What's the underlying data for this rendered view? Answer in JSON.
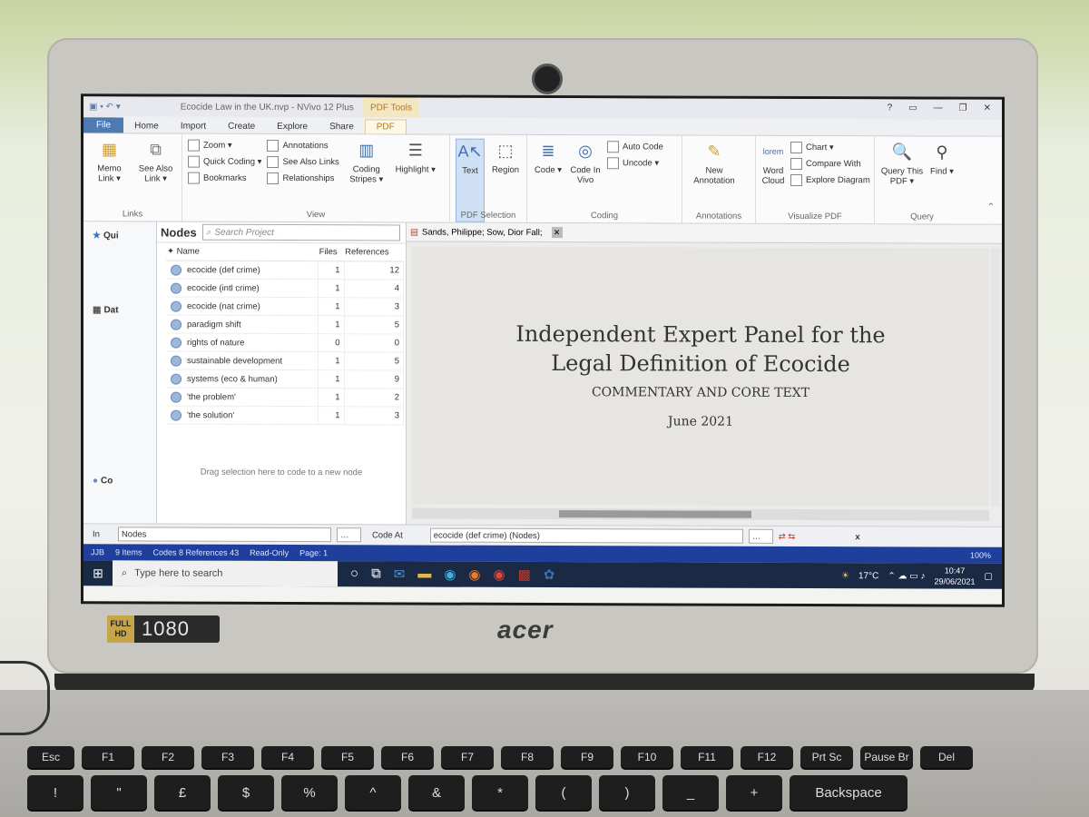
{
  "app": {
    "window_title": "Ecocide Law in the UK.nvp - NVivo 12 Plus",
    "context_tab": "PDF Tools",
    "tabs": [
      "File",
      "Home",
      "Import",
      "Create",
      "Explore",
      "Share",
      "PDF"
    ],
    "window_controls": [
      "?",
      "▭",
      "—",
      "❐",
      "✕"
    ]
  },
  "ribbon": {
    "links": {
      "memo_link": "Memo Link ▾",
      "see_also_link": "See Also Link ▾",
      "label": "Links"
    },
    "view": {
      "zoom": "Zoom ▾",
      "quick_coding": "Quick Coding ▾",
      "bookmarks": "Bookmarks",
      "annotations": "Annotations",
      "see_also_links": "See Also Links",
      "relationships": "Relationships",
      "coding_stripes": "Coding Stripes ▾",
      "highlight": "Highlight ▾",
      "label": "View"
    },
    "pdf_selection": {
      "text": "Text",
      "region": "Region",
      "label": "PDF Selection"
    },
    "coding": {
      "code": "Code ▾",
      "code_in_vivo": "Code In Vivo",
      "auto_code": "Auto Code",
      "uncode": "Uncode ▾",
      "label": "Coding"
    },
    "annotations": {
      "new_annotation": "New Annotation",
      "label": "Annotations"
    },
    "visualize": {
      "word_cloud": "Word Cloud",
      "chart": "Chart ▾",
      "compare_with": "Compare With",
      "explore_diagram": "Explore Diagram",
      "label": "Visualize PDF"
    },
    "query": {
      "query_this_pdf": "Query This PDF ▾",
      "find": "Find ▾",
      "label": "Query"
    }
  },
  "nav": {
    "items": [
      "Qui",
      "Dat",
      "Co"
    ]
  },
  "nodes": {
    "title": "Nodes",
    "search_placeholder": "Search Project",
    "columns": [
      "Name",
      "Files",
      "References"
    ],
    "rows": [
      {
        "name": "ecocide (def crime)",
        "files": "1",
        "refs": "12"
      },
      {
        "name": "ecocide (intl crime)",
        "files": "1",
        "refs": "4"
      },
      {
        "name": "ecocide (nat crime)",
        "files": "1",
        "refs": "3"
      },
      {
        "name": "paradigm shift",
        "files": "1",
        "refs": "5"
      },
      {
        "name": "rights of nature",
        "files": "0",
        "refs": "0"
      },
      {
        "name": "sustainable development",
        "files": "1",
        "refs": "5"
      },
      {
        "name": "systems (eco & human)",
        "files": "1",
        "refs": "9"
      },
      {
        "name": "'the problem'",
        "files": "1",
        "refs": "2"
      },
      {
        "name": "'the solution'",
        "files": "1",
        "refs": "3"
      }
    ],
    "drop_hint": "Drag selection here to code to a new node"
  },
  "document": {
    "tab_label": "Sands, Philippe; Sow, Dior Fall;",
    "title_line1": "Independent Expert Panel for the",
    "title_line2": "Legal Definition of Ecocide",
    "subtitle": "COMMENTARY AND CORE TEXT",
    "date": "June 2021"
  },
  "codebar": {
    "in_label": "In",
    "in_value": "Nodes",
    "code_at_label": "Code At",
    "code_at_value": "ecocide (def crime) (Nodes)",
    "close": "x"
  },
  "status": {
    "user": "JJB",
    "items": "9 Items",
    "codes": "Codes  8  References  43",
    "readonly": "Read-Only",
    "page": "Page: 1",
    "zoom": "100%"
  },
  "taskbar": {
    "search_placeholder": "Type here to search",
    "weather": "17°C",
    "time": "10:47",
    "date": "29/06/2021"
  },
  "device": {
    "badge_full": "FULL",
    "badge_hd": "HD",
    "badge_res": "1080",
    "brand": "acer"
  },
  "keyboard": {
    "fn_row": [
      "Esc",
      "F1",
      "F2",
      "F3",
      "F4",
      "F5",
      "F6",
      "F7",
      "F8",
      "F9",
      "F10",
      "F11",
      "F12",
      "Prt Sc",
      "Pause Br",
      "Del"
    ],
    "num_row": [
      "!",
      "\"",
      "£",
      "$",
      "%",
      "^",
      "&",
      "*",
      "(",
      ")",
      "_",
      "+",
      "Backspace"
    ]
  }
}
